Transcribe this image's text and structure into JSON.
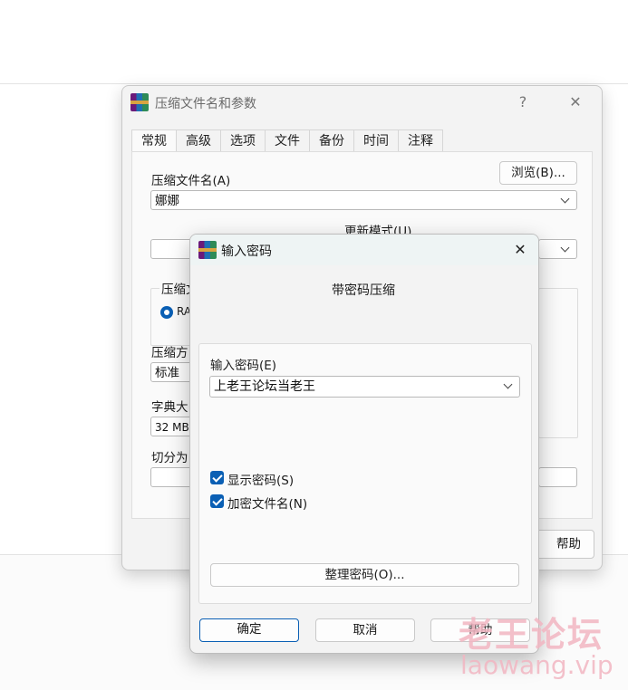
{
  "main_dialog": {
    "title": "压缩文件名和参数",
    "help_icon": "?",
    "close_icon": "✕",
    "tabs": [
      "常规",
      "高级",
      "选项",
      "文件",
      "备份",
      "时间",
      "注释"
    ],
    "archive_name_label": "压缩文件名(A)",
    "browse_label": "浏览(B)...",
    "archive_name_value": "娜娜",
    "update_mode_label": "更新模式(U)",
    "format_group_label_partial": "压缩文",
    "format_radio_partial": "RA",
    "method_label_partial": "压缩方",
    "method_value": "标准",
    "dict_label_partial": "字典大",
    "dict_value": "32 MB",
    "split_label_partial": "切分为",
    "help_button_partial": "帮助"
  },
  "password_dialog": {
    "title": "输入密码",
    "close_icon": "✕",
    "heading": "带密码压缩",
    "password_label": "输入密码(E)",
    "password_value": "上老王论坛当老王",
    "show_password_label": "显示密码(S)",
    "show_password_checked": true,
    "encrypt_names_label": "加密文件名(N)",
    "encrypt_names_checked": true,
    "organize_button": "整理密码(O)...",
    "ok_button": "确定",
    "cancel_button": "取消",
    "help_button": "帮助"
  },
  "watermark": {
    "line1": "老王论坛",
    "line2": "laowang.vip"
  },
  "colors": {
    "accent": "#0a5fb4",
    "watermark": "#f2b6c2"
  }
}
